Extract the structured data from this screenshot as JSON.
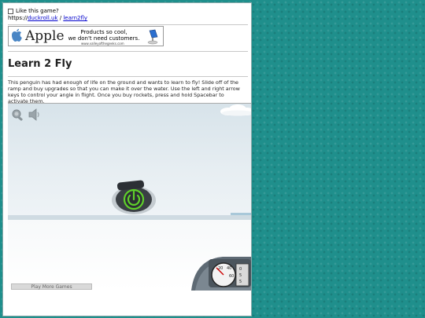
{
  "header": {
    "like_label": "Like this game?",
    "url_prefix": "https://",
    "url_site": "duckroll.uk",
    "url_sep": " / ",
    "url_page": "learn2fly"
  },
  "ad": {
    "brand": "Apple",
    "line1": "Products so cool,",
    "line2": "we don't need customers.",
    "site": "www.valleyofthegeeks.com"
  },
  "game_title": "Learn 2 Fly",
  "description": "This penguin has had enough of life on the ground and wants to learn to fly! Slide off of the ramp and buy upgrades so that you can make it over the water. Use the left and right arrow keys to control your angle in flight. Once you buy rockets, press and hold Spacebar to activate them.",
  "game": {
    "more_games_label": "Play More Games",
    "gauge_labels": [
      "20",
      "40",
      "60",
      "0",
      "5",
      "5"
    ]
  },
  "colors": {
    "background": "#1f8f8c",
    "link": "#0000cc",
    "power_glow": "#5fd12a"
  },
  "icons": [
    "apple-logo-icon",
    "mac-icon",
    "search-icon",
    "speaker-icon",
    "power-icon",
    "gauge-icon"
  ]
}
